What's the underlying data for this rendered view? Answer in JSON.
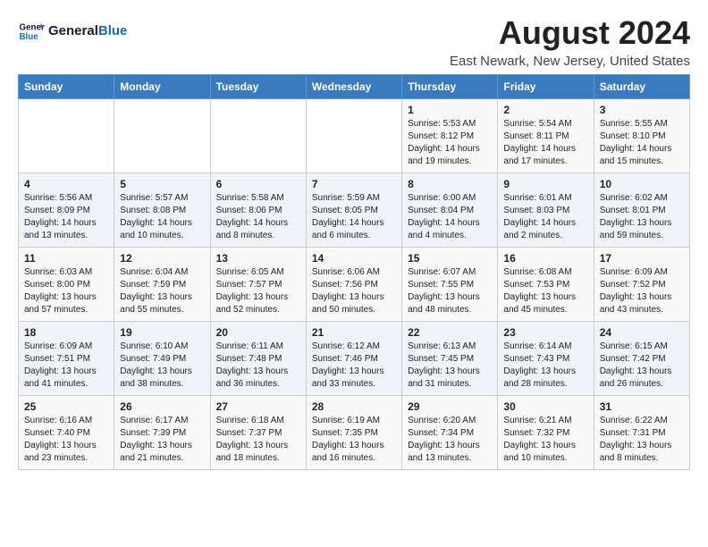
{
  "header": {
    "logo_line1": "General",
    "logo_line2": "Blue",
    "main_title": "August 2024",
    "sub_title": "East Newark, New Jersey, United States"
  },
  "weekdays": [
    "Sunday",
    "Monday",
    "Tuesday",
    "Wednesday",
    "Thursday",
    "Friday",
    "Saturday"
  ],
  "weeks": [
    [
      {
        "day": "",
        "info": ""
      },
      {
        "day": "",
        "info": ""
      },
      {
        "day": "",
        "info": ""
      },
      {
        "day": "",
        "info": ""
      },
      {
        "day": "1",
        "info": "Sunrise: 5:53 AM\nSunset: 8:12 PM\nDaylight: 14 hours\nand 19 minutes."
      },
      {
        "day": "2",
        "info": "Sunrise: 5:54 AM\nSunset: 8:11 PM\nDaylight: 14 hours\nand 17 minutes."
      },
      {
        "day": "3",
        "info": "Sunrise: 5:55 AM\nSunset: 8:10 PM\nDaylight: 14 hours\nand 15 minutes."
      }
    ],
    [
      {
        "day": "4",
        "info": "Sunrise: 5:56 AM\nSunset: 8:09 PM\nDaylight: 14 hours\nand 13 minutes."
      },
      {
        "day": "5",
        "info": "Sunrise: 5:57 AM\nSunset: 8:08 PM\nDaylight: 14 hours\nand 10 minutes."
      },
      {
        "day": "6",
        "info": "Sunrise: 5:58 AM\nSunset: 8:06 PM\nDaylight: 14 hours\nand 8 minutes."
      },
      {
        "day": "7",
        "info": "Sunrise: 5:59 AM\nSunset: 8:05 PM\nDaylight: 14 hours\nand 6 minutes."
      },
      {
        "day": "8",
        "info": "Sunrise: 6:00 AM\nSunset: 8:04 PM\nDaylight: 14 hours\nand 4 minutes."
      },
      {
        "day": "9",
        "info": "Sunrise: 6:01 AM\nSunset: 8:03 PM\nDaylight: 14 hours\nand 2 minutes."
      },
      {
        "day": "10",
        "info": "Sunrise: 6:02 AM\nSunset: 8:01 PM\nDaylight: 13 hours\nand 59 minutes."
      }
    ],
    [
      {
        "day": "11",
        "info": "Sunrise: 6:03 AM\nSunset: 8:00 PM\nDaylight: 13 hours\nand 57 minutes."
      },
      {
        "day": "12",
        "info": "Sunrise: 6:04 AM\nSunset: 7:59 PM\nDaylight: 13 hours\nand 55 minutes."
      },
      {
        "day": "13",
        "info": "Sunrise: 6:05 AM\nSunset: 7:57 PM\nDaylight: 13 hours\nand 52 minutes."
      },
      {
        "day": "14",
        "info": "Sunrise: 6:06 AM\nSunset: 7:56 PM\nDaylight: 13 hours\nand 50 minutes."
      },
      {
        "day": "15",
        "info": "Sunrise: 6:07 AM\nSunset: 7:55 PM\nDaylight: 13 hours\nand 48 minutes."
      },
      {
        "day": "16",
        "info": "Sunrise: 6:08 AM\nSunset: 7:53 PM\nDaylight: 13 hours\nand 45 minutes."
      },
      {
        "day": "17",
        "info": "Sunrise: 6:09 AM\nSunset: 7:52 PM\nDaylight: 13 hours\nand 43 minutes."
      }
    ],
    [
      {
        "day": "18",
        "info": "Sunrise: 6:09 AM\nSunset: 7:51 PM\nDaylight: 13 hours\nand 41 minutes."
      },
      {
        "day": "19",
        "info": "Sunrise: 6:10 AM\nSunset: 7:49 PM\nDaylight: 13 hours\nand 38 minutes."
      },
      {
        "day": "20",
        "info": "Sunrise: 6:11 AM\nSunset: 7:48 PM\nDaylight: 13 hours\nand 36 minutes."
      },
      {
        "day": "21",
        "info": "Sunrise: 6:12 AM\nSunset: 7:46 PM\nDaylight: 13 hours\nand 33 minutes."
      },
      {
        "day": "22",
        "info": "Sunrise: 6:13 AM\nSunset: 7:45 PM\nDaylight: 13 hours\nand 31 minutes."
      },
      {
        "day": "23",
        "info": "Sunrise: 6:14 AM\nSunset: 7:43 PM\nDaylight: 13 hours\nand 28 minutes."
      },
      {
        "day": "24",
        "info": "Sunrise: 6:15 AM\nSunset: 7:42 PM\nDaylight: 13 hours\nand 26 minutes."
      }
    ],
    [
      {
        "day": "25",
        "info": "Sunrise: 6:16 AM\nSunset: 7:40 PM\nDaylight: 13 hours\nand 23 minutes."
      },
      {
        "day": "26",
        "info": "Sunrise: 6:17 AM\nSunset: 7:39 PM\nDaylight: 13 hours\nand 21 minutes."
      },
      {
        "day": "27",
        "info": "Sunrise: 6:18 AM\nSunset: 7:37 PM\nDaylight: 13 hours\nand 18 minutes."
      },
      {
        "day": "28",
        "info": "Sunrise: 6:19 AM\nSunset: 7:35 PM\nDaylight: 13 hours\nand 16 minutes."
      },
      {
        "day": "29",
        "info": "Sunrise: 6:20 AM\nSunset: 7:34 PM\nDaylight: 13 hours\nand 13 minutes."
      },
      {
        "day": "30",
        "info": "Sunrise: 6:21 AM\nSunset: 7:32 PM\nDaylight: 13 hours\nand 10 minutes."
      },
      {
        "day": "31",
        "info": "Sunrise: 6:22 AM\nSunset: 7:31 PM\nDaylight: 13 hours\nand 8 minutes."
      }
    ]
  ]
}
